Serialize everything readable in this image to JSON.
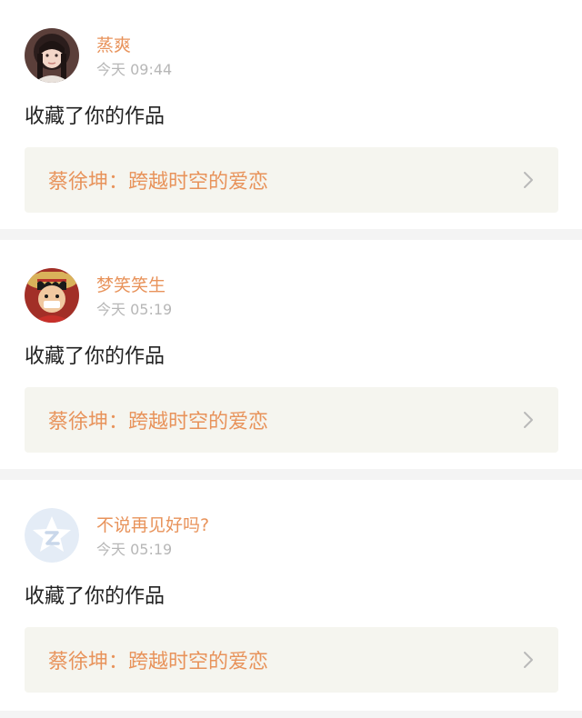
{
  "notifications": [
    {
      "user_name": "蒸爽",
      "time": "今天 09:44",
      "action": "收藏了你的作品",
      "work_title": "蔡徐坤：跨越时空的爱恋",
      "avatar_icon": "girl-photo-avatar"
    },
    {
      "user_name": "梦笑笑生",
      "time": "今天 05:19",
      "action": "收藏了你的作品",
      "work_title": "蔡徐坤：跨越时空的爱恋",
      "avatar_icon": "anime-luffy-avatar"
    },
    {
      "user_name": "不说再见好吗?",
      "time": "今天 05:19",
      "action": "收藏了你的作品",
      "work_title": "蔡徐坤：跨越时空的爱恋",
      "avatar_icon": "default-star-avatar"
    }
  ],
  "colors": {
    "accent": "#e8935b",
    "muted": "#b7b7b7",
    "text": "#222222",
    "work_bg": "#f5f5ef",
    "page_bg": "#f4f4f4"
  }
}
